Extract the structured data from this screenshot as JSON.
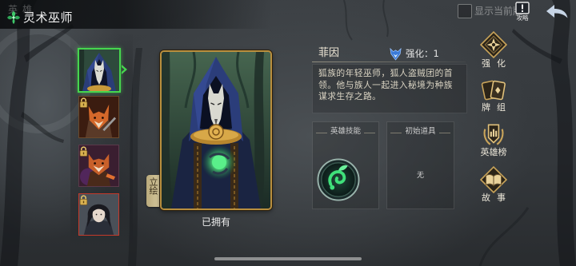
{
  "top_bar": {
    "background_label": "英雄",
    "title": "灵术巫师",
    "title_icon": "green-clover-icon",
    "show_current_label": "显示当前版",
    "show_current_checked": false,
    "guide_label": "攻略",
    "guide_icon": "guide-notice-icon",
    "back_icon": "back-arrow-icon"
  },
  "hero_list": [
    {
      "icon": "hooded-wolf-wizard-portrait",
      "selected": true,
      "locked": false
    },
    {
      "icon": "fox-warrior-portrait",
      "selected": false,
      "locked": true
    },
    {
      "icon": "red-panda-portrait",
      "selected": false,
      "locked": true
    },
    {
      "icon": "human-hero-portrait",
      "selected": false,
      "locked": true
    }
  ],
  "card": {
    "art_tab_label": "立绘",
    "ownership_status": "已拥有"
  },
  "hero_info": {
    "name": "菲因",
    "enhance_icon": "blue-wolf-crest-icon",
    "enhance_label": "强化：1",
    "description_lines": [
      "狐族的年轻巫师，狐人盗贼团的首",
      "领。他与族人一起进入秘境为种族",
      "谋求生存之路。"
    ]
  },
  "skill_panel": {
    "label": "英雄技能",
    "skill_icon": "green-spiral-skill-icon"
  },
  "item_panel": {
    "label": "初始道具",
    "value": "无"
  },
  "side_menu": [
    {
      "label": "强化",
      "icon": "enhance-diamond-icon"
    },
    {
      "label": "牌组",
      "icon": "card-deck-icon"
    },
    {
      "label": "英雄榜",
      "icon": "hero-ranking-icon"
    },
    {
      "label": "故事",
      "icon": "story-book-icon"
    }
  ],
  "colors": {
    "selected_border": "#46d64e",
    "frame_gold": "#b98f3e",
    "locked_red_border": "#c4392a",
    "text_light": "#ece6d6"
  }
}
